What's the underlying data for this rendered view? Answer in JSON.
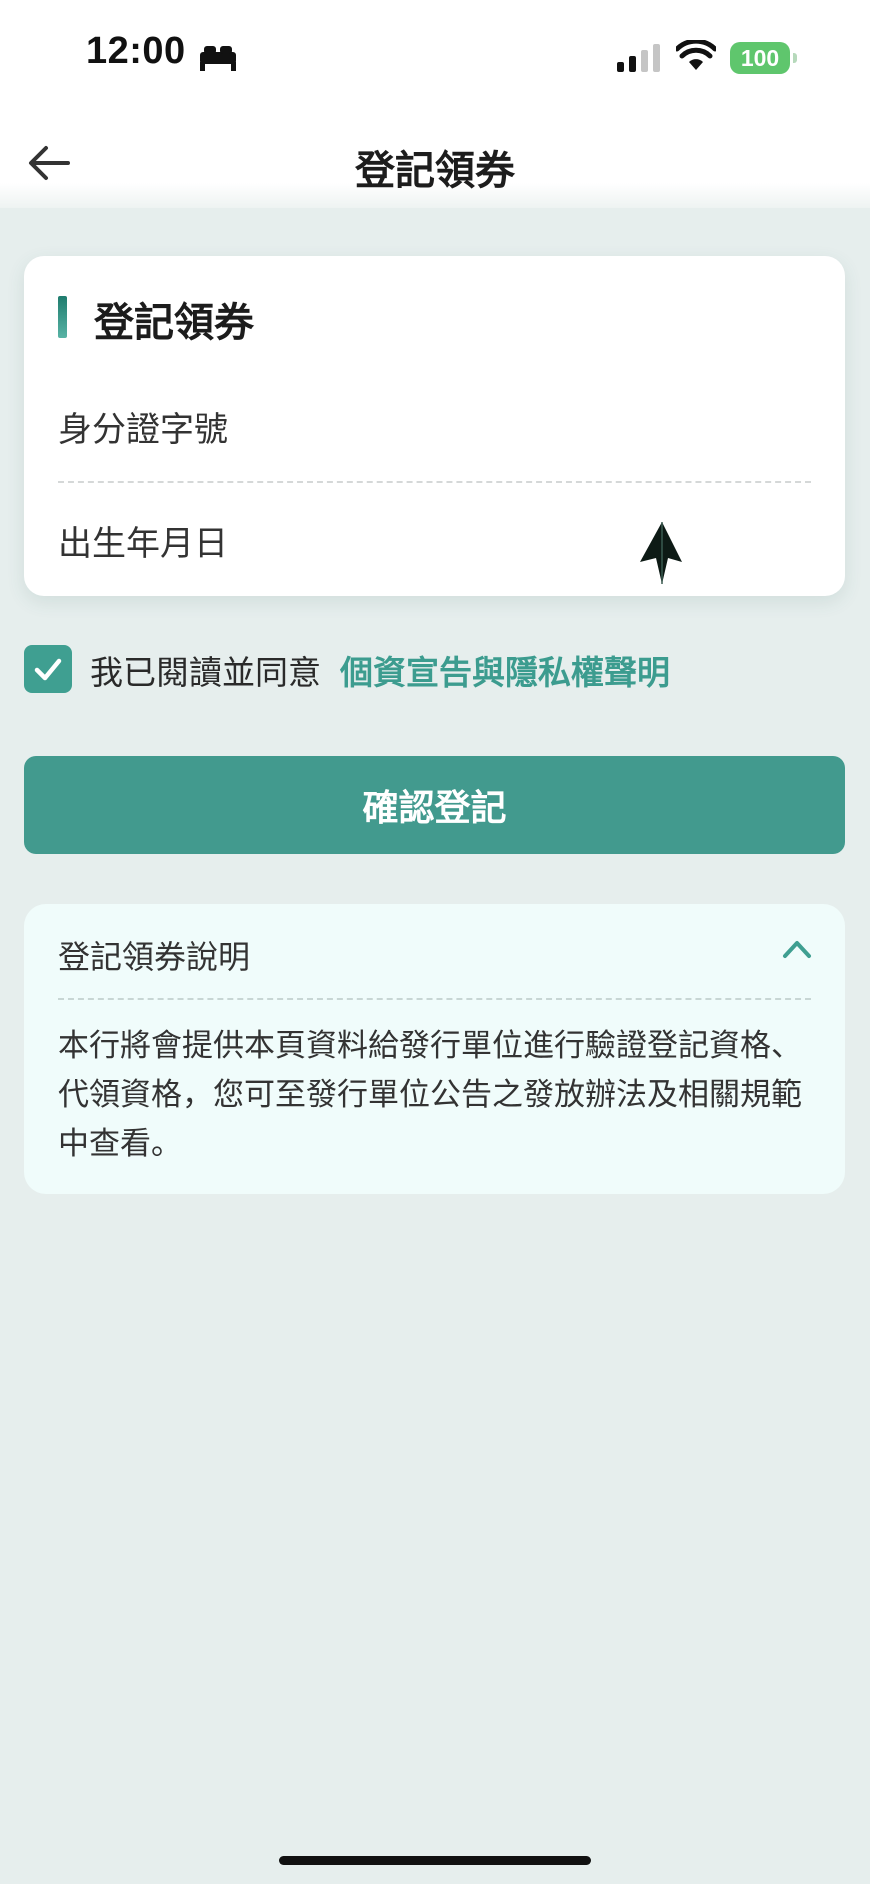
{
  "status_bar": {
    "time": "12:00",
    "battery": "100"
  },
  "header": {
    "title": "登記領券"
  },
  "form": {
    "title": "登記領券",
    "id_label": "身分證字號",
    "id_value": "",
    "birth_label": "出生年月日",
    "birth_value": ""
  },
  "agreement": {
    "checked": true,
    "text": "我已閱讀並同意",
    "link": "個資宣告與隱私權聲明"
  },
  "confirm_button": "確認登記",
  "info": {
    "title": "登記領券說明",
    "expanded": true,
    "body": "本行將會提供本頁資料給發行單位進行驗證登記資格、代領資格，您可至發行單位公告之發放辦法及相關規範中查看。"
  },
  "colors": {
    "accent": "#429a8e",
    "link": "#3c9c8f",
    "background": "#e6eeed"
  }
}
